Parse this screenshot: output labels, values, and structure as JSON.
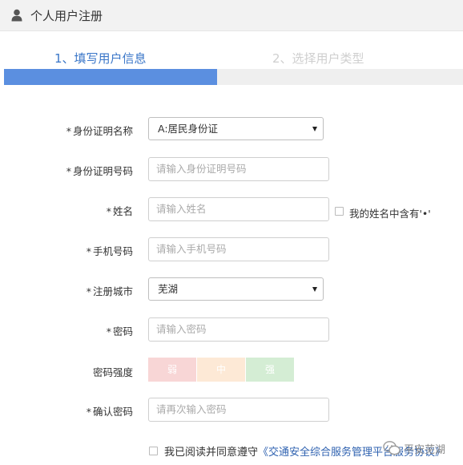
{
  "header": {
    "title": "个人用户注册",
    "icon": "user-icon"
  },
  "steps": {
    "step1": "1、填写用户信息",
    "step2": "2、选择用户类型",
    "progress": 0.465,
    "active_color": "#3a76c8",
    "inactive_color": "#cfcfcf",
    "bar_color": "#5b8fe0"
  },
  "form": {
    "id_type": {
      "label": "身份证明名称",
      "value": "A:居民身份证"
    },
    "id_number": {
      "label": "身份证明号码",
      "placeholder": "请输入身份证明号码"
    },
    "name": {
      "label": "姓名",
      "placeholder": "请输入姓名",
      "checkbox_label": "我的姓名中含有'•'"
    },
    "phone": {
      "label": "手机号码",
      "placeholder": "请输入手机号码"
    },
    "city": {
      "label": "注册城市",
      "value": "芜湖"
    },
    "password": {
      "label": "密码",
      "placeholder": "请输入密码"
    },
    "strength": {
      "label": "密码强度",
      "levels": [
        "弱",
        "中",
        "强"
      ]
    },
    "confirm": {
      "label": "确认密码",
      "placeholder": "请再次输入密码"
    },
    "required_mark": "*"
  },
  "agreement": {
    "text": "我已阅读并同意遵守",
    "link": "《交通安全综合服务管理平台服务协议》"
  },
  "watermark": {
    "text": "平安芜湖",
    "icon": "wechat-icon"
  }
}
